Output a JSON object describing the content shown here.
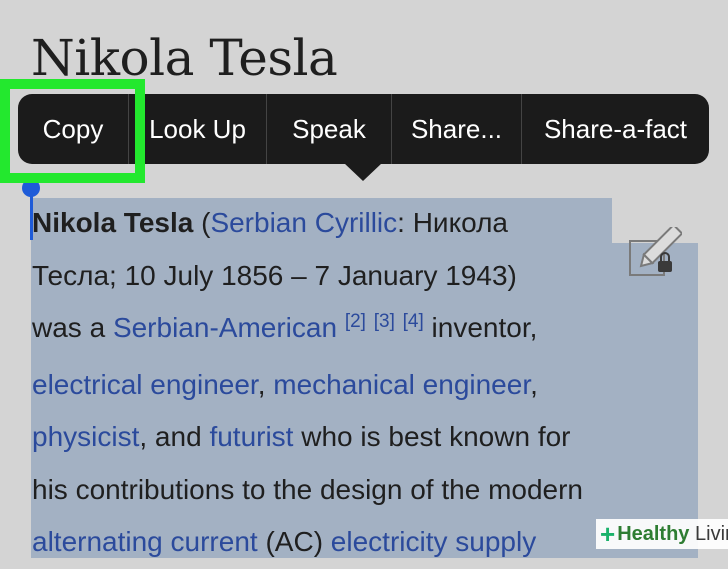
{
  "page": {
    "title": "Nikola Tesla"
  },
  "context_menu": {
    "items": [
      {
        "label": "Copy"
      },
      {
        "label": "Look Up"
      },
      {
        "label": "Speak"
      },
      {
        "label": "Share..."
      },
      {
        "label": "Share-a-fact"
      }
    ],
    "highlighted_item": "Copy",
    "highlight_color": "#23e82e"
  },
  "article": {
    "line1": {
      "subject": "Nikola Tesla",
      "open_paren": " (",
      "link": "Serbian Cyrillic",
      "text": ": Никола"
    },
    "line2": {
      "text": "Тесла; 10 July 1856 – 7 January 1943)"
    },
    "line3": {
      "pre": "was a ",
      "link": "Serbian-American",
      "refs": [
        "[2]",
        "[3]",
        "[4]"
      ],
      "post": " inventor,"
    },
    "line4": {
      "link1": "electrical engineer",
      "sep": ", ",
      "link2": "mechanical engineer",
      "post": ","
    },
    "line5": {
      "link1": "physicist",
      "mid": ", and ",
      "link2": "futurist",
      "post": " who is best known for"
    },
    "line6": {
      "text": "his contributions to the design of the modern"
    },
    "line7": {
      "link1": "alternating current",
      "mid": " (AC) ",
      "link2": "electricity supply"
    }
  },
  "icons": {
    "edit": "edit-lock-icon"
  },
  "colors": {
    "selection": "#a3b1c3",
    "link": "#2b4a9c",
    "selection_handle": "#1e5bd8",
    "menu_bg": "#1b1b1b"
  },
  "watermark": {
    "brand": "Healthy",
    "suffix": "Living"
  }
}
